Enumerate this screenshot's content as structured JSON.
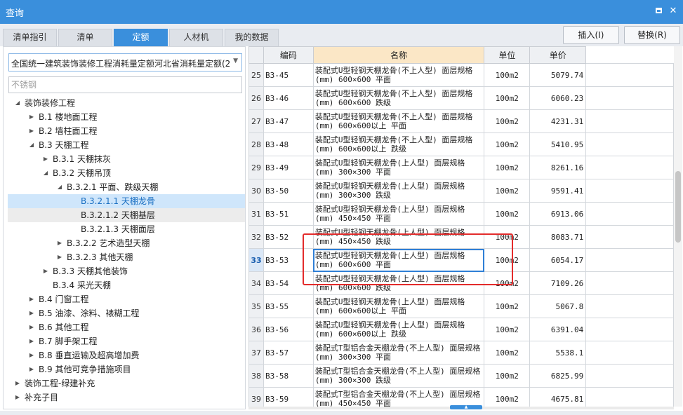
{
  "window": {
    "title": "查询",
    "maximize_icon": "maximize-icon",
    "close_icon": "close-icon"
  },
  "tabs": [
    {
      "label": "清单指引",
      "active": false
    },
    {
      "label": "清单",
      "active": false
    },
    {
      "label": "定额",
      "active": true
    },
    {
      "label": "人材机",
      "active": false
    },
    {
      "label": "我的数据",
      "active": false
    }
  ],
  "toolbar": {
    "insert_label": "插入(I)",
    "replace_label": "替换(R)"
  },
  "left": {
    "quota_select": "全国统一建筑装饰装修工程消耗量定额河北省消耗量定额(2012)",
    "search_value": "",
    "search_placeholder": "不锈钢"
  },
  "tree": [
    {
      "label": "装饰装修工程",
      "level": 0,
      "arrow": "◢",
      "state": ""
    },
    {
      "label": "B.1 楼地面工程",
      "level": 1,
      "arrow": "▶",
      "state": ""
    },
    {
      "label": "B.2 墙柱面工程",
      "level": 1,
      "arrow": "▶",
      "state": ""
    },
    {
      "label": "B.3 天棚工程",
      "level": 1,
      "arrow": "◢",
      "state": ""
    },
    {
      "label": "B.3.1 天棚抹灰",
      "level": 2,
      "arrow": "▶",
      "state": ""
    },
    {
      "label": "B.3.2 天棚吊顶",
      "level": 2,
      "arrow": "◢",
      "state": ""
    },
    {
      "label": "B.3.2.1 平面、跌级天棚",
      "level": 3,
      "arrow": "◢",
      "state": ""
    },
    {
      "label": "B.3.2.1.1 天棚龙骨",
      "level": 4,
      "arrow": "",
      "state": "selected"
    },
    {
      "label": "B.3.2.1.2 天棚基层",
      "level": 4,
      "arrow": "",
      "state": "hover"
    },
    {
      "label": "B.3.2.1.3 天棚面层",
      "level": 4,
      "arrow": "",
      "state": ""
    },
    {
      "label": "B.3.2.2 艺术造型天棚",
      "level": 3,
      "arrow": "▶",
      "state": ""
    },
    {
      "label": "B.3.2.3 其他天棚",
      "level": 3,
      "arrow": "▶",
      "state": ""
    },
    {
      "label": "B.3.3 天棚其他装饰",
      "level": 2,
      "arrow": "▶",
      "state": ""
    },
    {
      "label": "B.3.4 采光天棚",
      "level": 2,
      "arrow": "",
      "state": ""
    },
    {
      "label": "B.4 门窗工程",
      "level": 1,
      "arrow": "▶",
      "state": ""
    },
    {
      "label": "B.5 油漆、涂料、裱糊工程",
      "level": 1,
      "arrow": "▶",
      "state": ""
    },
    {
      "label": "B.6 其他工程",
      "level": 1,
      "arrow": "▶",
      "state": ""
    },
    {
      "label": "B.7 脚手架工程",
      "level": 1,
      "arrow": "▶",
      "state": ""
    },
    {
      "label": "B.8 垂直运输及超高增加费",
      "level": 1,
      "arrow": "▶",
      "state": ""
    },
    {
      "label": "B.9 其他可竞争措施项目",
      "level": 1,
      "arrow": "▶",
      "state": ""
    },
    {
      "label": "装饰工程-绿建补充",
      "level": 0,
      "arrow": "▶",
      "state": ""
    },
    {
      "label": "补充子目",
      "level": 0,
      "arrow": "▶",
      "state": ""
    }
  ],
  "grid": {
    "headers": {
      "rownum": "",
      "code": "编码",
      "name": "名称",
      "unit": "单位",
      "price": "单价"
    },
    "rows": [
      {
        "num": "25",
        "code": "B3-45",
        "name": "装配式U型轻钢天棚龙骨(不上人型) 面层规格(mm) 600×600 平面",
        "unit": "100m2",
        "price": "5079.74"
      },
      {
        "num": "26",
        "code": "B3-46",
        "name": "装配式U型轻钢天棚龙骨(不上人型) 面层规格(mm) 600×600 跌级",
        "unit": "100m2",
        "price": "6060.23"
      },
      {
        "num": "27",
        "code": "B3-47",
        "name": "装配式U型轻钢天棚龙骨(不上人型) 面层规格(mm) 600×600以上 平面",
        "unit": "100m2",
        "price": "4231.31"
      },
      {
        "num": "28",
        "code": "B3-48",
        "name": "装配式U型轻钢天棚龙骨(不上人型) 面层规格(mm) 600×600以上 跌级",
        "unit": "100m2",
        "price": "5410.95"
      },
      {
        "num": "29",
        "code": "B3-49",
        "name": "装配式U型轻钢天棚龙骨(上人型) 面层规格(mm) 300×300 平面",
        "unit": "100m2",
        "price": "8261.16"
      },
      {
        "num": "30",
        "code": "B3-50",
        "name": "装配式U型轻钢天棚龙骨(上人型) 面层规格(mm) 300×300 跌级",
        "unit": "100m2",
        "price": "9591.41"
      },
      {
        "num": "31",
        "code": "B3-51",
        "name": "装配式U型轻钢天棚龙骨(上人型) 面层规格(mm) 450×450 平面",
        "unit": "100m2",
        "price": "6913.06"
      },
      {
        "num": "32",
        "code": "B3-52",
        "name": "装配式U型轻钢天棚龙骨(上人型) 面层规格(mm) 450×450 跌级",
        "unit": "100m2",
        "price": "8083.71"
      },
      {
        "num": "33",
        "code": "B3-53",
        "name": "装配式U型轻钢天棚龙骨(上人型) 面层规格(mm) 600×600 平面",
        "unit": "100m2",
        "price": "6054.17"
      },
      {
        "num": "34",
        "code": "B3-54",
        "name": "装配式U型轻钢天棚龙骨(上人型) 面层规格(mm) 600×600 跌级",
        "unit": "100m2",
        "price": "7109.26"
      },
      {
        "num": "35",
        "code": "B3-55",
        "name": "装配式U型轻钢天棚龙骨(上人型) 面层规格(mm) 600×600以上 平面",
        "unit": "100m2",
        "price": "5067.8"
      },
      {
        "num": "36",
        "code": "B3-56",
        "name": "装配式U型轻钢天棚龙骨(上人型) 面层规格(mm) 600×600以上 跌级",
        "unit": "100m2",
        "price": "6391.04"
      },
      {
        "num": "37",
        "code": "B3-57",
        "name": "装配式T型铝合金天棚龙骨(不上人型) 面层规格(mm) 300×300 平面",
        "unit": "100m2",
        "price": "5538.1"
      },
      {
        "num": "38",
        "code": "B3-58",
        "name": "装配式T型铝合金天棚龙骨(不上人型) 面层规格(mm) 300×300 跌级",
        "unit": "100m2",
        "price": "6825.99"
      },
      {
        "num": "39",
        "code": "B3-59",
        "name": "装配式T型铝合金天棚龙骨(不上人型) 面层规格(mm) 450×450 平面",
        "unit": "100m2",
        "price": "4675.81"
      }
    ],
    "active_row": "33"
  }
}
